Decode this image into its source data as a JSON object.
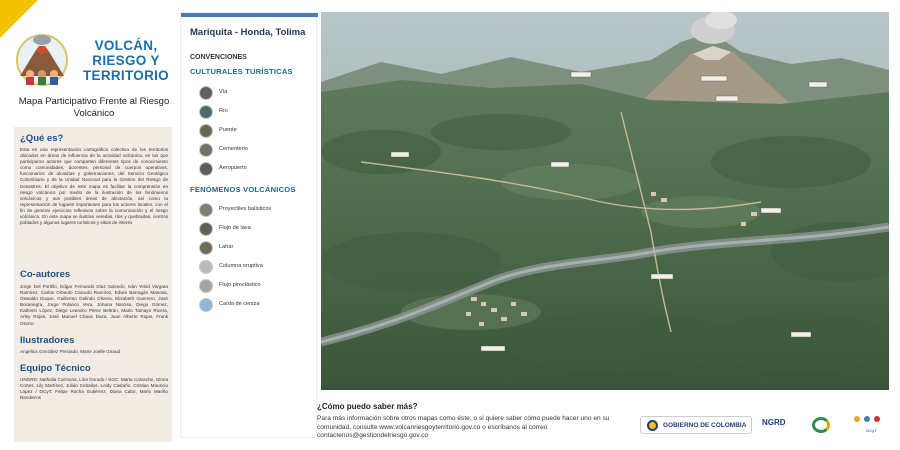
{
  "header": {
    "title": "VOLCÁN, RIESGO Y TERRITORIO",
    "subtitle": "Mapa Participativo Frente al Riesgo Volcánico"
  },
  "info": {
    "what_heading": "¿Qué es?",
    "what_text": "Esta es una representación cartográfica colectiva de los territorios ubicados en áreas de influencia de la actividad volcánica, en las que participaron actores que comparten diferentes tipos de conocimiento como comunidades, docentes, personal de cuerpos operativos, funcionarios de alcaldías y gobernaciones, del Servicio Geológico Colombiano y de la Unidad Nacional para la Gestión del Riesgo de Desastres. El objetivo de este mapa es facilitar la comprensión en riesgo volcánico por medio de la ilustración de los fenómenos volcánicos y sus posibles áreas de afectación, así como la representación de lugares importantes para los actores locales, con el fin de generar ejercicios reflexivos sobre la comunicación y el riesgo volcánico. En este mapa se ilustran veredas, ríos y quebradas, centros poblados y algunos lugares turísticos y sitios de interés",
    "coauthors_heading": "Co-autores",
    "coauthors_text": "Jorge Del Portillo, Edgar Fernando Díaz Salcedo, Iván Yesid Vergara Ramírez, Carlos Orlando Caicedo Ramírez, Edwin Barragán Manosa, Oswaldo Duque, Guillermo Galindo Olivera, Elizabeth Guerrero, José Bocanegra, Jorge Polanco Vera, Johana Narciso, Diego Gómez, Katherin López, Diego Leandro Pérez Beltrán, Mario Tamayo Rivera, Arley Rojas, José Manuel Chaux Daza, Juan Alberto Rojas, Frank Osorio",
    "illustrators_heading": "Ilustradores",
    "illustrators_text": "Angelica González Preciado, Marie Joelle Giraud",
    "team_heading": "Equipo Técnico",
    "team_text": "UNGRD: Nathalia Carmona, Lina Dorado / SGC: Marta Calvache, Gloria Cortes, Lily Martínez, Julián Ceballos, Leidy Castaño, Cristian Mauricio López / OCyT: Felipe Rocha Gutiérrez, Diana Cabo, Mario Mariño Rendeiros"
  },
  "legend": {
    "location": "Mariquita - Honda, Tolima",
    "conventions_label": "CONVENCIONES",
    "cultural_heading": "CULTURALES TURÍSTICAS",
    "cultural_items": [
      {
        "label": "Vía",
        "icon": "road-icon",
        "color": "#5b625a"
      },
      {
        "label": "Río",
        "icon": "river-icon",
        "color": "#4f6a6f"
      },
      {
        "label": "Puente",
        "icon": "bridge-icon",
        "color": "#5f6c57"
      },
      {
        "label": "Cementerio",
        "icon": "cemetery-icon",
        "color": "#6b7466"
      },
      {
        "label": "Aeropuerto",
        "icon": "airport-icon",
        "color": "#59615b"
      }
    ],
    "volcanic_heading": "FENÓMENOS VOLCÁNICOS",
    "volcanic_items": [
      {
        "label": "Proyectiles balísticos",
        "icon": "ballistic-icon",
        "color": "#7d8070"
      },
      {
        "label": "Flujo de lava",
        "icon": "lava-icon",
        "color": "#5d6355"
      },
      {
        "label": "Lahar",
        "icon": "lahar-icon",
        "color": "#6f6a5a"
      },
      {
        "label": "Columna eruptiva",
        "icon": "eruption-column-icon",
        "color": "#b9bcbf"
      },
      {
        "label": "Flujo piroclástico",
        "icon": "pyroclastic-icon",
        "color": "#a6a49c"
      },
      {
        "label": "Caída de ceniza",
        "icon": "ash-fall-icon",
        "color": "#8fb6d9"
      }
    ]
  },
  "footer": {
    "question": "¿Cómo puedo saber más?",
    "text": "Para más información sobre otros mapas como éste, o si quiere saber cómo puede hacer uno en su comunidad, consulte www.volcanriesgoyterritorio.gov.co o escríbanos al correo contactenos@gestiondelriesgo.gov.co",
    "gov_label": "GOBIERNO DE COLOMBIA",
    "ngrd_label": "NGRD",
    "ocyt_label": "OCyT"
  },
  "colors": {
    "accent_blue": "#1d6fa5",
    "heading_blue": "#1c4f8a",
    "corner_yellow": "#f2c200",
    "info_bg": "#f3ece5"
  }
}
